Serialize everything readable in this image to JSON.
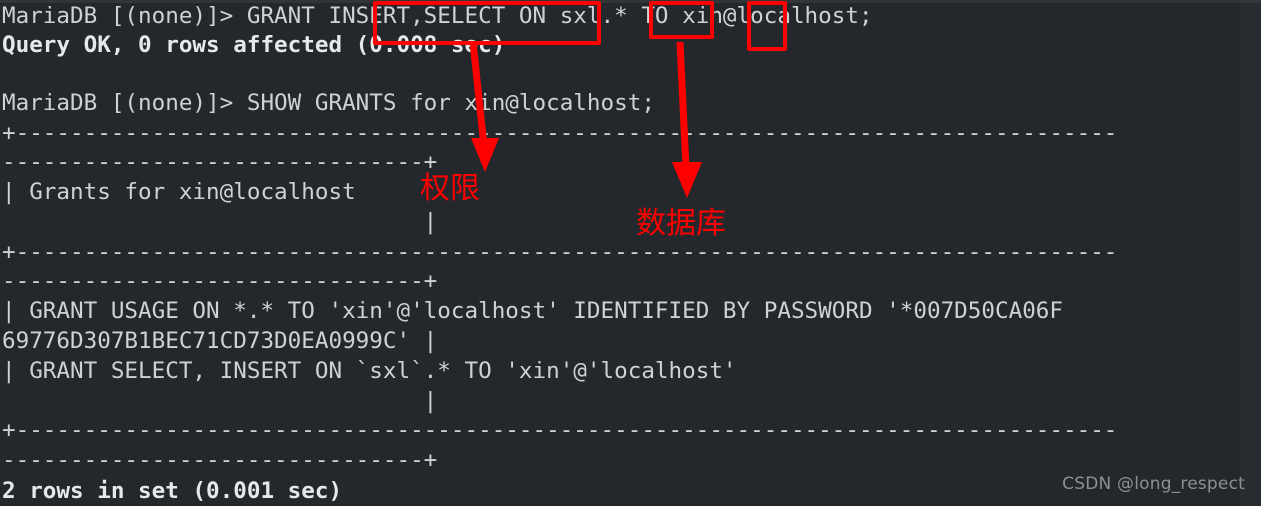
{
  "terminal": {
    "background_color": "#24282c",
    "foreground_color": "#cfd2d4",
    "lines": [
      {
        "text": "MariaDB [(none)]> GRANT INSERT,SELECT ON sxl.* TO xin@localhost;",
        "bold": false
      },
      {
        "text": "Query OK, 0 rows affected (0.008 sec)",
        "bold": true
      },
      {
        "text": "",
        "bold": false
      },
      {
        "text": "MariaDB [(none)]> SHOW GRANTS for xin@localhost;",
        "bold": false
      },
      {
        "text": "+---------------------------------------------------------------------------------",
        "bold": false
      },
      {
        "text": "-------------------------------+",
        "bold": false
      },
      {
        "text": "| Grants for xin@localhost",
        "bold": false
      },
      {
        "text": "                               |",
        "bold": false
      },
      {
        "text": "+---------------------------------------------------------------------------------",
        "bold": false
      },
      {
        "text": "-------------------------------+",
        "bold": false
      },
      {
        "text": "| GRANT USAGE ON *.* TO 'xin'@'localhost' IDENTIFIED BY PASSWORD '*007D50CA06F",
        "bold": false
      },
      {
        "text": "69776D307B1BEC71CD73D0EA0999C' |",
        "bold": false
      },
      {
        "text": "| GRANT SELECT, INSERT ON `sxl`.* TO 'xin'@'localhost'",
        "bold": false
      },
      {
        "text": "                               |",
        "bold": false
      },
      {
        "text": "+---------------------------------------------------------------------------------",
        "bold": false
      },
      {
        "text": "-------------------------------+",
        "bold": false
      },
      {
        "text": "2 rows in set (0.001 sec)",
        "bold": true
      }
    ]
  },
  "annotations": {
    "color": "#fe0000",
    "boxes": [
      {
        "name": "privileges-highlight",
        "target_text": "INSERT,SELECT"
      },
      {
        "name": "database-highlight",
        "target_text": "sxl."
      },
      {
        "name": "to-keyword-highlight",
        "target_text": "TO"
      }
    ],
    "labels": [
      {
        "name": "privileges-label",
        "text": "权限"
      },
      {
        "name": "database-label",
        "text": "数据库"
      }
    ]
  },
  "watermark": {
    "text": "CSDN @long_respect"
  }
}
